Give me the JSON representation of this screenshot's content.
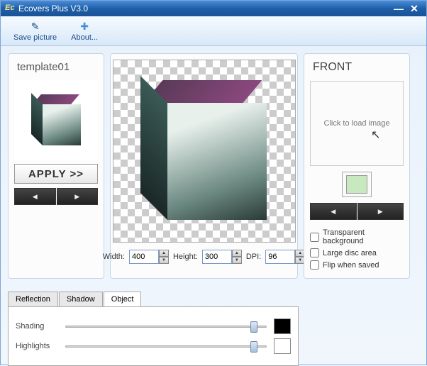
{
  "window": {
    "title": "Ecovers Plus V3.0"
  },
  "toolbar": {
    "save_picture": "Save picture",
    "about": "About..."
  },
  "template": {
    "name": "template01",
    "apply": "APPLY >>"
  },
  "dimensions": {
    "width_label": "Width:",
    "width_value": "400",
    "height_label": "Height:",
    "height_value": "300",
    "dpi_label": "DPI:",
    "dpi_value": "96"
  },
  "front": {
    "title": "FRONT",
    "placeholder": "Click to load image",
    "swatch_color": "#c8e8c0"
  },
  "options": {
    "transparent_bg": "Transparent background",
    "large_disc": "Large disc area",
    "flip_saved": "Flip when saved"
  },
  "tabs": {
    "reflection": "Reflection",
    "shadow": "Shadow",
    "object": "Object"
  },
  "sliders": {
    "shading_label": "Shading",
    "shading_color": "#000000",
    "highlights_label": "Highlights",
    "highlights_color": "#ffffff"
  }
}
